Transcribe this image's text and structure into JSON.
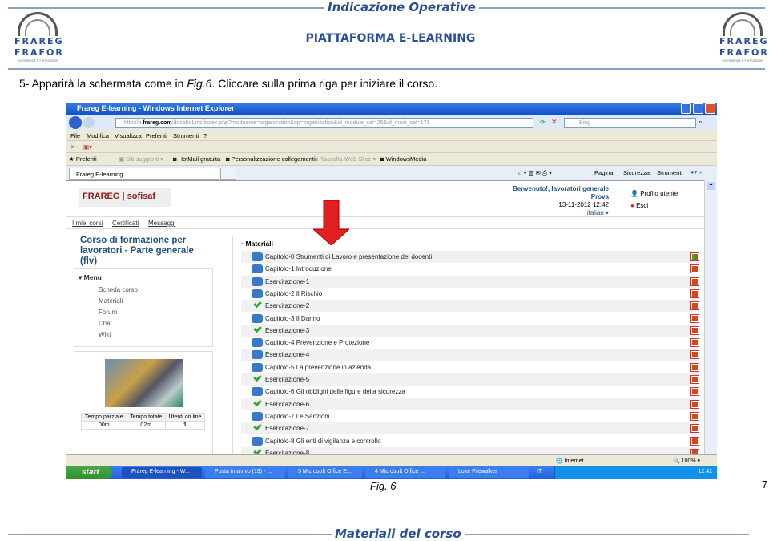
{
  "header": {
    "title": "Indicazione Operative",
    "platform": "PIATTAFORMA E-LEARNING",
    "logo_text": [
      "FRAREG",
      "FRAFOR",
      "Consulenza e Formazione"
    ]
  },
  "instruction": {
    "prefix": "5-  Apparirà la schermata come in ",
    "fig_ref": "Fig.6",
    "suffix": ". Cliccare sulla prima riga per iniziare il corso."
  },
  "browser": {
    "title": "Frareg E-learning - Windows Internet Explorer",
    "url_prefix": "http://e.",
    "url_domain": "frareg.com",
    "url_rest": "/doceboLms/index.php?modname=organization&op=organization&id_module_sel=25&id_main_sel=171",
    "search_placeholder": "Bing",
    "menu": [
      "File",
      "Modifica",
      "Visualizza",
      "Preferiti",
      "Strumenti",
      "?"
    ],
    "favorites": [
      "Preferiti",
      "Siti suggeriti",
      "HotMail gratuita",
      "Personalizzazione collegamenti",
      "Raccolta Web Slice",
      "WindowsMedia"
    ],
    "tab": "Frareg E-learning",
    "commands": [
      "Pagina",
      "Sicurezza",
      "Strumenti"
    ],
    "status_zone": "Internet",
    "zoom": "100%"
  },
  "site": {
    "logo": "FRAREG | sofisaf",
    "nav": [
      "I miei corsi",
      "Certificati",
      "Messaggi"
    ],
    "course_title": "Corso di formazione per lavoratori - Parte generale (flv)",
    "menu_title": "Menu",
    "menu_items": [
      "Scheda corso",
      "Materiali",
      "Forum",
      "Chat",
      "Wiki"
    ],
    "stats": {
      "headers": [
        "Tempo parziale",
        "Tempo totale",
        "Utenti on line"
      ],
      "values": [
        "00m",
        "02m",
        "1"
      ]
    },
    "user": {
      "welcome": "Benvenuto!, lavoratori generale",
      "name": "Prova",
      "datetime": "13-11-2012 12:42",
      "language": "italian"
    },
    "user_links": [
      "Profilo utente",
      "Esci"
    ],
    "materials_title": "Materiali",
    "materials": [
      {
        "label": "Capitolo-0 Strumenti di Lavoro e presentazione dei docenti",
        "done": false
      },
      {
        "label": "Capitolo-1 Introduzione",
        "done": false
      },
      {
        "label": "Esercitazione-1",
        "done": false
      },
      {
        "label": "Capitolo-2 Il Rischio",
        "done": false
      },
      {
        "label": "Esercitazione-2",
        "done": true
      },
      {
        "label": "Capitolo-3 Il Danno",
        "done": false
      },
      {
        "label": "Esercitazione-3",
        "done": true
      },
      {
        "label": "Capitolo-4 Prevenzione e Protezione",
        "done": false
      },
      {
        "label": "Esercitazione-4",
        "done": false
      },
      {
        "label": "Capitolo-5 La prevenzione in azienda",
        "done": false
      },
      {
        "label": "Esercitazione-5",
        "done": true
      },
      {
        "label": "Capitolo-6 Gli obblighi delle figure della sicurezza",
        "done": false
      },
      {
        "label": "Esercitazione-6",
        "done": true
      },
      {
        "label": "Capitolo-7 Le Sanzioni",
        "done": false
      },
      {
        "label": "Esercitazione-7",
        "done": true
      },
      {
        "label": "Capitolo-8 Gli enti di vigilanza e controllo",
        "done": false
      },
      {
        "label": "Esercitazione-8",
        "done": true
      }
    ]
  },
  "taskbar": {
    "start": "start",
    "tasks": [
      "Frareg E-learning - W...",
      "Posta in arrivo (19) - ...",
      "5 Microsoft Office E...",
      "4 Microsoft Office ...",
      "Luke Filewalker"
    ],
    "lang": "IT",
    "clock": "12.42"
  },
  "caption": "Fig. 6",
  "page_number": "7",
  "footer": "Materiali del corso",
  "colors": {
    "heading_blue": "#2a4f9a",
    "arrow_red": "#e02020",
    "course_title": "#1f4f8a"
  }
}
